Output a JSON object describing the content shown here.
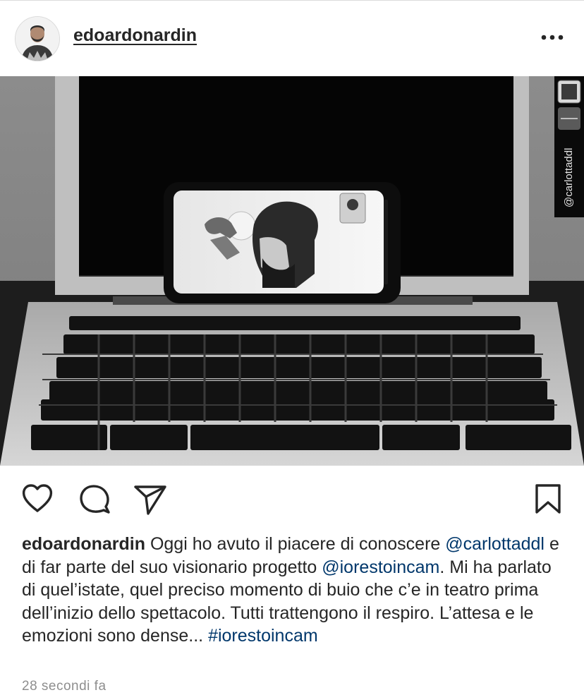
{
  "post": {
    "username": "edoardonardin",
    "more_icon": "more-horizontal-icon",
    "photo_watermark": "@carlottaddl"
  },
  "actions": {
    "like_icon": "heart-icon",
    "comment_icon": "comment-icon",
    "share_icon": "send-icon",
    "save_icon": "bookmark-icon"
  },
  "caption": {
    "username": "edoardonardin",
    "part1": " Oggi ho avuto il piacere di conoscere ",
    "mention1": "@carlottaddl",
    "part2": " e di far parte del suo visionario progetto ",
    "mention2": "@iorestoincam",
    "part3": ". Mi ha parlato di quel’istate, quel preciso momento di buio che c’e in teatro prima dell’inizio dello spettacolo. Tutti trattengono il respiro. L’attesa e le emozioni sono dense... ",
    "hashtag": "#iorestoincam"
  },
  "timestamp": "28 secondi fa",
  "colors": {
    "text": "#262626",
    "link": "#00376b",
    "muted": "#8e8e8e",
    "divider": "#dbdbdb"
  }
}
